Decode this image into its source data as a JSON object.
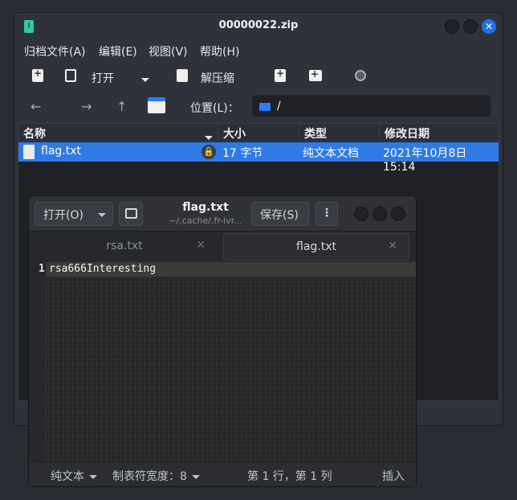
{
  "archive": {
    "title": "00000022.zip",
    "menu": [
      "归档文件(A)",
      "编辑(E)",
      "视图(V)",
      "帮助(H)"
    ],
    "toolbar": {
      "open_label": "打开",
      "extract_label": "解压缩"
    },
    "location": {
      "label": "位置(L)：",
      "path": "/"
    },
    "columns": [
      "名称",
      "大小",
      "类型",
      "修改日期"
    ],
    "files": [
      {
        "name": "flag.txt",
        "size": "17 字节",
        "type": "纯文本文档",
        "modified": "2021年10月8日 15:14"
      }
    ],
    "close_glyph": "✕"
  },
  "editor": {
    "open_label": "打开(O)",
    "title": "flag.txt",
    "subtitle": "~/.cache/.fr-ivr...",
    "save_label": "保存(S)",
    "tabs": [
      {
        "label": "rsa.txt",
        "active": false
      },
      {
        "label": "flag.txt",
        "active": true
      }
    ],
    "lines": [
      {
        "number": "1",
        "text": "rsa666Interesting"
      }
    ],
    "status": {
      "language": "纯文本",
      "tab_width": "制表符宽度：8",
      "position": "第 1 行，第 1 列",
      "mode": "插入"
    }
  },
  "colors": {
    "accent": "#2f7ae5",
    "folder": "#2e7cf6"
  }
}
